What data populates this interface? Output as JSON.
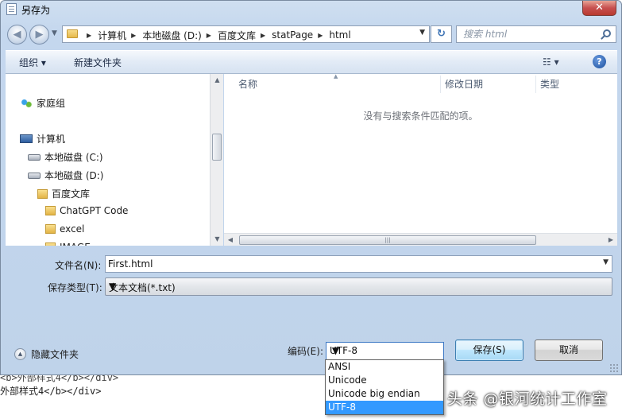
{
  "window": {
    "title": "另存为",
    "close_symbol": "✕"
  },
  "address": {
    "crumbs": [
      "计算机",
      "本地磁盘 (D:)",
      "百度文库",
      "statPage",
      "html"
    ],
    "search_placeholder": "搜索 html"
  },
  "toolbar": {
    "organize_label": "组织 ▾",
    "new_folder_label": "新建文件夹",
    "view_label": "☷ ▾",
    "help_label": "?"
  },
  "nav_pane": {
    "items": [
      {
        "label": "家庭组",
        "icon": "homegroup-icon"
      },
      {
        "label": "计算机",
        "icon": "computer-icon"
      },
      {
        "label": "本地磁盘 (C:)",
        "icon": "drive-icon"
      },
      {
        "label": "本地磁盘 (D:)",
        "icon": "drive-icon"
      },
      {
        "label": "百度文库",
        "icon": "folder-icon"
      },
      {
        "label": "ChatGPT Code",
        "icon": "folder-icon"
      },
      {
        "label": "excel",
        "icon": "folder-icon"
      },
      {
        "label": "IMAGE",
        "icon": "folder-icon"
      }
    ]
  },
  "file_list": {
    "columns": [
      "名称",
      "修改日期",
      "类型"
    ],
    "empty_message": "没有与搜索条件匹配的项。"
  },
  "form": {
    "filename_label": "文件名(N):",
    "filename_value": "First.html",
    "filetype_label": "保存类型(T):",
    "filetype_value": "文本文档(*.txt)",
    "encoding_label": "编码(E):",
    "encoding_value": "UTF-8",
    "encoding_options": [
      "ANSI",
      "Unicode",
      "Unicode big endian",
      "UTF-8"
    ],
    "encoding_selected_index": 3
  },
  "buttons": {
    "save": "保存(S)",
    "cancel": "取消",
    "hide_folders": "隐藏文件夹"
  },
  "background_editor": {
    "line1": "<b>外部样式4</b></div>",
    "line2": "外部样式4</b></div>"
  },
  "watermark": "头条 @银河统计工作室",
  "colors": {
    "selection": "#3399ff",
    "close_button": "#c75050",
    "dialog_frame": "#c4d7ee"
  }
}
